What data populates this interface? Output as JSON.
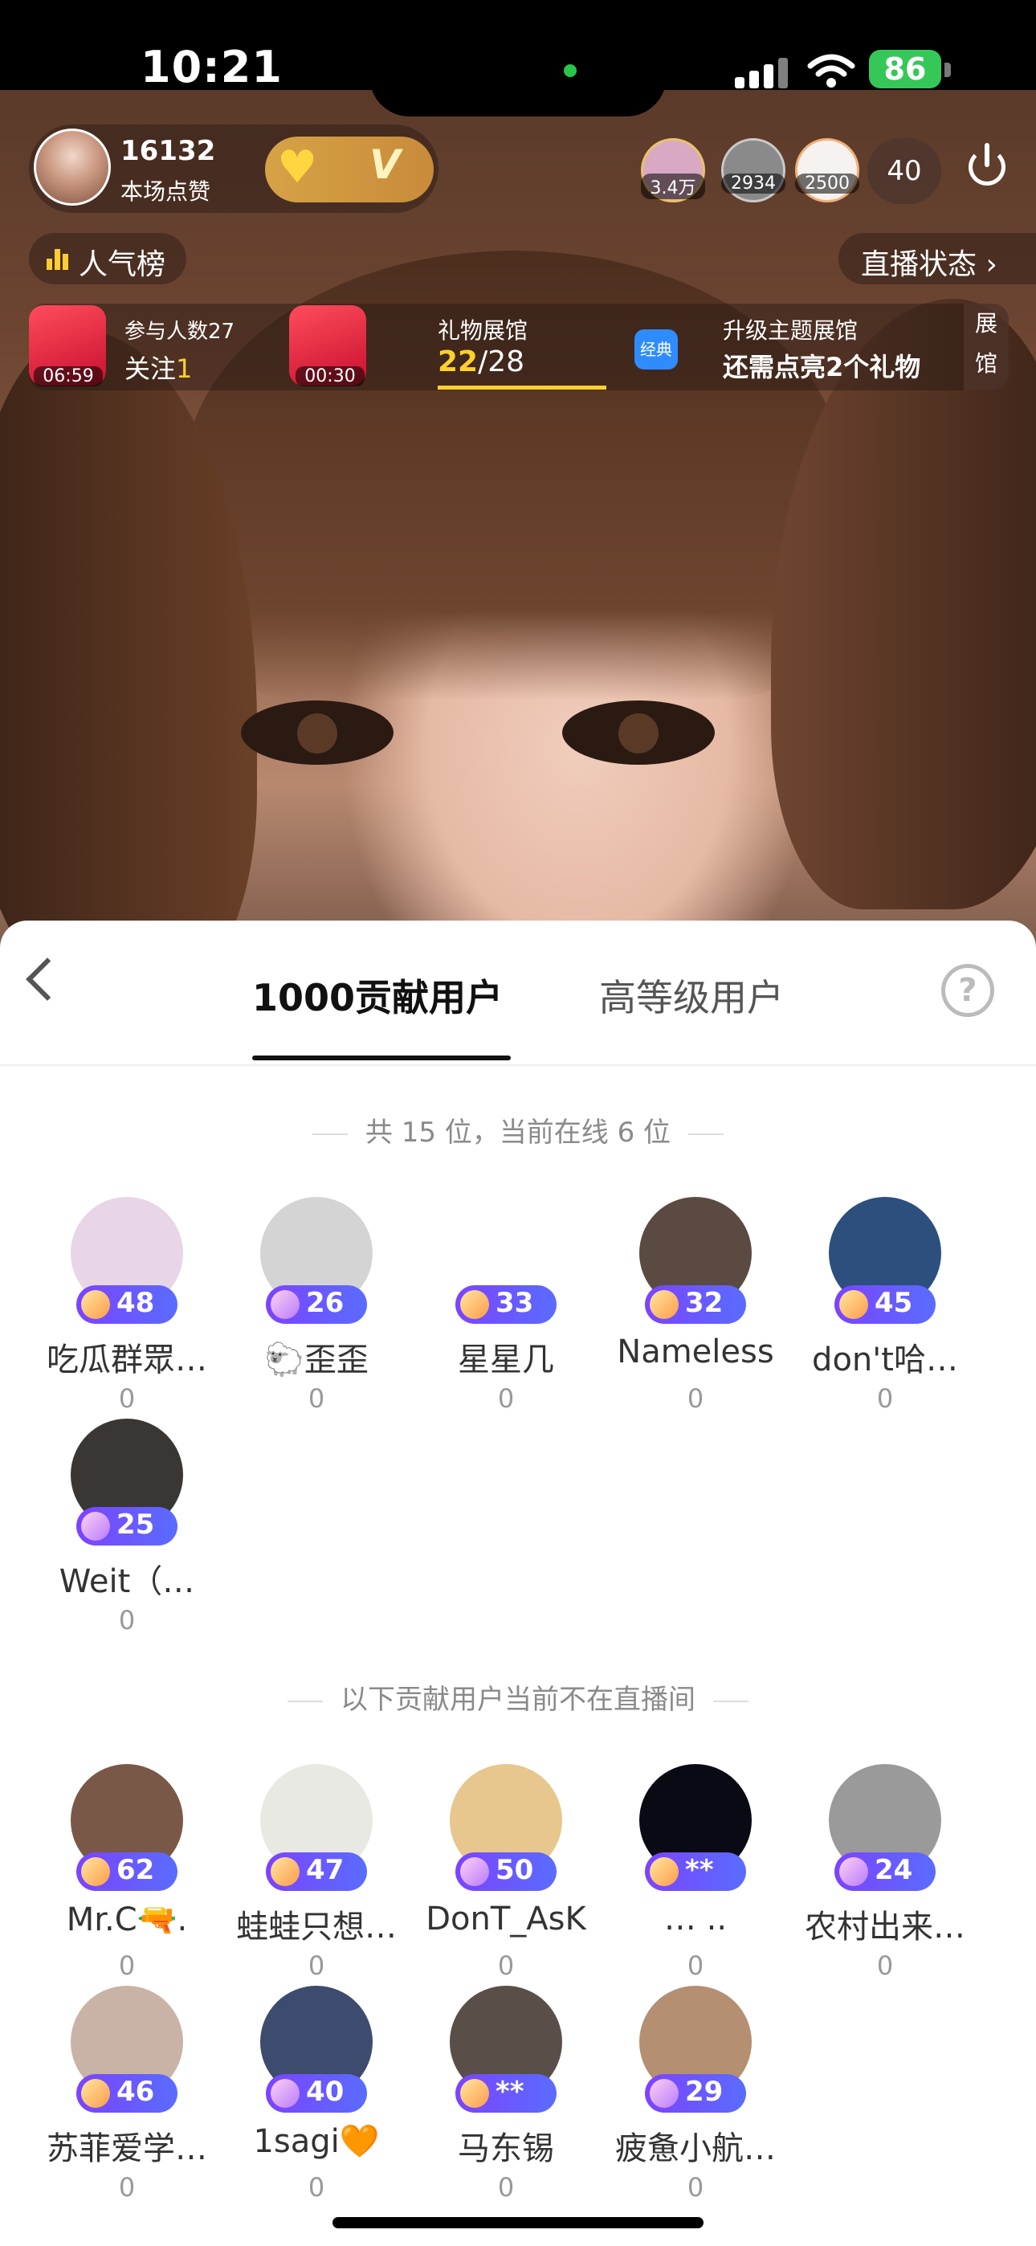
{
  "status_bar": {
    "time": "10:21",
    "battery": "86"
  },
  "live": {
    "host_likes": "16132",
    "host_likes_label": "本场点赞",
    "top_viewers": [
      {
        "count": "3.4万",
        "color": "#d9a9c4"
      },
      {
        "count": "2934",
        "color": "#8a8a8a"
      },
      {
        "count": "2500",
        "color": "#f6f2f0"
      }
    ],
    "viewer_total": "40",
    "rank_label": "人气榜",
    "status_label": "直播状态 ›",
    "activity": {
      "packet1_label": "参与人数27",
      "packet1_sub": "关注",
      "packet1_sub_count": "1",
      "packet1_time": "06:59",
      "packet2_time": "00:30",
      "gift_hall_label": "礼物展馆",
      "gift_progress_have": "22",
      "gift_progress_total": "/28",
      "classic_badge": "经典",
      "upgrade_label": "升级主题展馆",
      "upgrade_sub": "还需点亮2个礼物",
      "showroom_side": "展 馆"
    }
  },
  "panel": {
    "tabs": [
      "1000贡献用户",
      "高等级用户"
    ],
    "online_header": "共 15 位，当前在线 6 位",
    "offline_header": "以下贡献用户当前不在直播间",
    "online_users": [
      {
        "name": "吃瓜群眾…",
        "level": "48",
        "score": "0",
        "avatar": "#e8d6e6",
        "gem": "gold"
      },
      {
        "name": "🐑歪歪",
        "level": "26",
        "score": "0",
        "avatar": "#d4d4d4",
        "gem": "pink"
      },
      {
        "name": "星星几",
        "level": "33",
        "score": "0",
        "avatar": "#ffffff",
        "gem": "gold"
      },
      {
        "name": "Nameless",
        "level": "32",
        "score": "0",
        "avatar": "#5a4a42",
        "gem": "gold"
      },
      {
        "name": "don't哈…",
        "level": "45",
        "score": "0",
        "avatar": "#2c4f7e",
        "gem": "gold"
      },
      {
        "name": "Weit（…",
        "level": "25",
        "score": "0",
        "avatar": "#3a3634",
        "gem": "pink"
      }
    ],
    "offline_users": [
      {
        "name": "Mr.C🔫.",
        "level": "62",
        "score": "0",
        "avatar": "#7a5848",
        "gem": "gold"
      },
      {
        "name": "蛙蛙只想…",
        "level": "47",
        "score": "0",
        "avatar": "#e9e9e3",
        "gem": "gold"
      },
      {
        "name": "DonT_AsK",
        "level": "50",
        "score": "0",
        "avatar": "#e7c78d",
        "gem": "pink"
      },
      {
        "name": "… ..",
        "level": "**",
        "score": "0",
        "avatar": "#0a0a14",
        "gem": "gold"
      },
      {
        "name": "农村出来…",
        "level": "24",
        "score": "0",
        "avatar": "#9a9a9a",
        "gem": "pink"
      },
      {
        "name": "苏菲爱学…",
        "level": "46",
        "score": "0",
        "avatar": "#c9b2a6",
        "gem": "gold"
      },
      {
        "name": "1sagi🧡",
        "level": "40",
        "score": "0",
        "avatar": "#3d4c6e",
        "gem": "pink"
      },
      {
        "name": "马东锡",
        "level": "**",
        "score": "0",
        "avatar": "#5a4f48",
        "gem": "gold"
      },
      {
        "name": "疲惫小航…",
        "level": "29",
        "score": "0",
        "avatar": "#b58f72",
        "gem": "pink"
      }
    ]
  }
}
